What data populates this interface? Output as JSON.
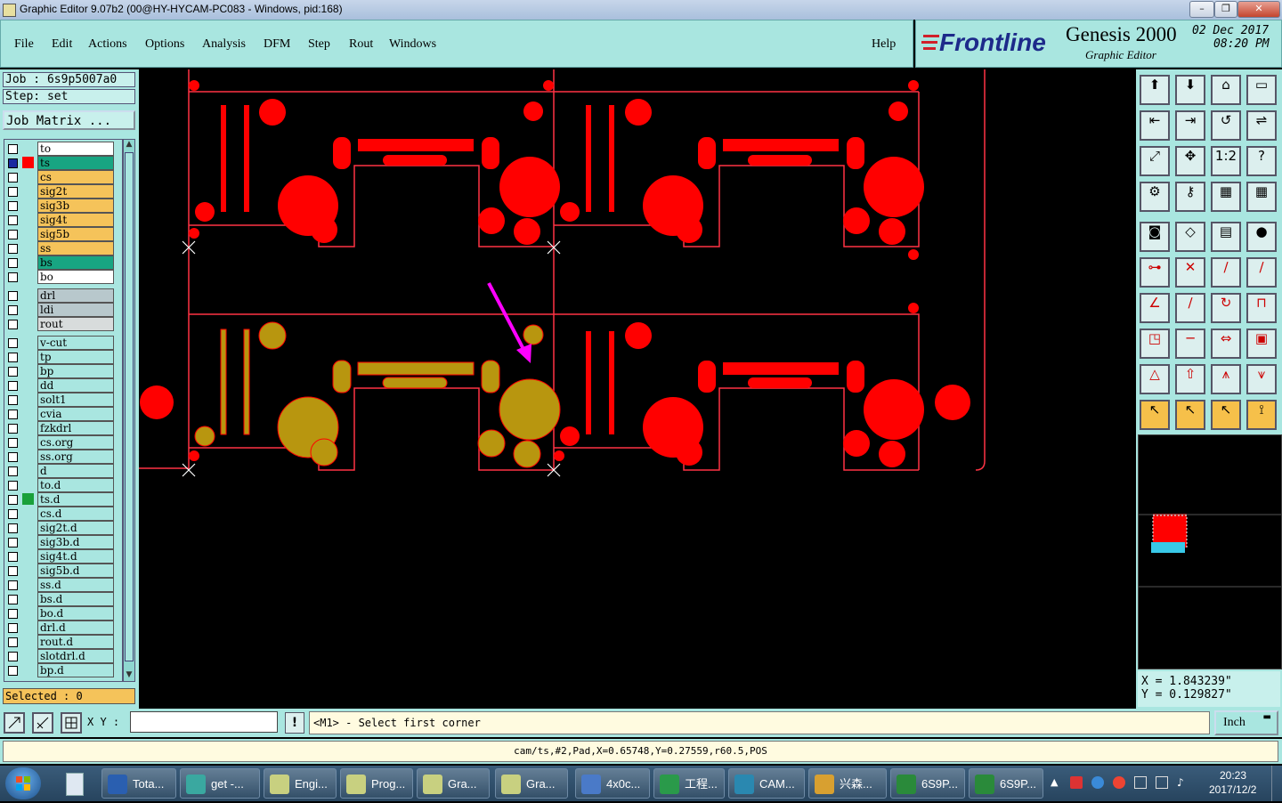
{
  "window": {
    "title": "Graphic Editor 9.07b2 (00@HY-HYCAM-PC083 - Windows, pid:168)"
  },
  "menu": [
    "File",
    "Edit",
    "Actions",
    "Options",
    "Analysis",
    "DFM",
    "Step",
    "Rout",
    "Windows"
  ],
  "help_label": "Help",
  "brand": {
    "logo": "Frontline",
    "product": "Genesis 2000",
    "subtitle": "Graphic Editor",
    "date": "02 Dec 2017",
    "time": "08:20 PM"
  },
  "job": {
    "job": "Job : 6s9p5007a0",
    "step": "Step: set",
    "matrix_button": "Job Matrix ..."
  },
  "layers": [
    {
      "name": "to",
      "color": "#ffffff"
    },
    {
      "name": "ts",
      "color": "#18a582",
      "active": true
    },
    {
      "name": "cs",
      "color": "#f5c35a"
    },
    {
      "name": "sig2t",
      "color": "#f5c35a"
    },
    {
      "name": "sig3b",
      "color": "#f5c35a"
    },
    {
      "name": "sig4t",
      "color": "#f5c35a"
    },
    {
      "name": "sig5b",
      "color": "#f5c35a"
    },
    {
      "name": "ss",
      "color": "#f5c35a"
    },
    {
      "name": "bs",
      "color": "#18a582"
    },
    {
      "name": "bo",
      "color": "#ffffff"
    },
    {
      "name": "drl",
      "color": "#b8c8cc",
      "gap": true
    },
    {
      "name": "ldi",
      "color": "#b8c8cc"
    },
    {
      "name": "rout",
      "color": "#d8dcdc"
    },
    {
      "name": "v-cut",
      "color": "#a9e6e0",
      "gap": true
    },
    {
      "name": "tp",
      "color": "#a9e6e0"
    },
    {
      "name": "bp",
      "color": "#a9e6e0"
    },
    {
      "name": "dd",
      "color": "#a9e6e0"
    },
    {
      "name": "solt1",
      "color": "#a9e6e0"
    },
    {
      "name": "cvia",
      "color": "#a9e6e0"
    },
    {
      "name": "fzkdrl",
      "color": "#a9e6e0"
    },
    {
      "name": "cs.org",
      "color": "#a9e6e0"
    },
    {
      "name": "ss.org",
      "color": "#a9e6e0"
    },
    {
      "name": "d",
      "color": "#a9e6e0"
    },
    {
      "name": "to.d",
      "color": "#a9e6e0"
    },
    {
      "name": "ts.d",
      "color": "#a9e6e0",
      "marked": true
    },
    {
      "name": "cs.d",
      "color": "#a9e6e0"
    },
    {
      "name": "sig2t.d",
      "color": "#a9e6e0"
    },
    {
      "name": "sig3b.d",
      "color": "#a9e6e0"
    },
    {
      "name": "sig4t.d",
      "color": "#a9e6e0"
    },
    {
      "name": "sig5b.d",
      "color": "#a9e6e0"
    },
    {
      "name": "ss.d",
      "color": "#a9e6e0"
    },
    {
      "name": "bs.d",
      "color": "#a9e6e0"
    },
    {
      "name": "bo.d",
      "color": "#a9e6e0"
    },
    {
      "name": "drl.d",
      "color": "#a9e6e0"
    },
    {
      "name": "rout.d",
      "color": "#a9e6e0"
    },
    {
      "name": "slotdrl.d",
      "color": "#a9e6e0"
    },
    {
      "name": "bp.d",
      "color": "#a9e6e0"
    }
  ],
  "selected": "Selected : 0",
  "coords": {
    "x": "X = 1.843239\"",
    "y": "Y = 0.129827\""
  },
  "xy": {
    "label": "X Y :",
    "value": "",
    "prompt": "<M1> - Select first corner",
    "units": "Inch"
  },
  "status": "cam/ts,#2,Pad,X=0.65748,Y=0.27559,r60.5,POS",
  "taskbar": {
    "items": [
      "Tota...",
      "get -...",
      "Engi...",
      "Prog...",
      "Gra...",
      "Gra...",
      "4x0c...",
      "工程...",
      "CAM...",
      "兴森...",
      "6S9P...",
      "6S9P..."
    ],
    "time": "20:23",
    "date": "2017/12/2"
  },
  "colors": {
    "panel": "#a9e6e0",
    "pad": "#ff0000",
    "highlight": "#b8960f",
    "arrow": "#ff00ff"
  }
}
